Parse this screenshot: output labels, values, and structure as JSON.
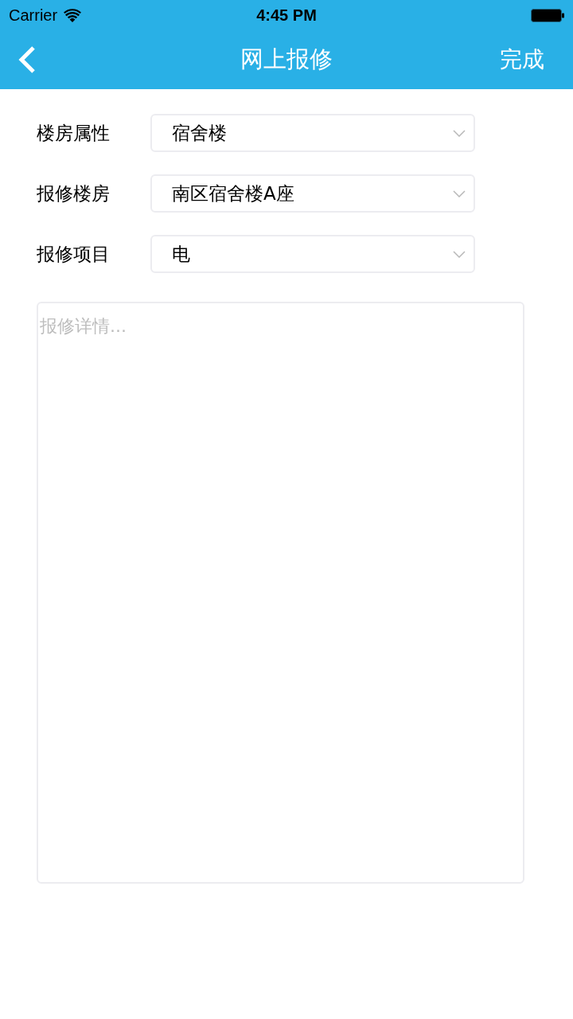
{
  "status_bar": {
    "carrier": "Carrier",
    "time": "4:45 PM"
  },
  "nav_bar": {
    "title": "网上报修",
    "action": "完成"
  },
  "form": {
    "fields": [
      {
        "label": "楼房属性",
        "value": "宿舍楼"
      },
      {
        "label": "报修楼房",
        "value": "南区宿舍楼A座"
      },
      {
        "label": "报修项目",
        "value": "电"
      }
    ]
  },
  "details": {
    "placeholder": "报修详情..."
  }
}
